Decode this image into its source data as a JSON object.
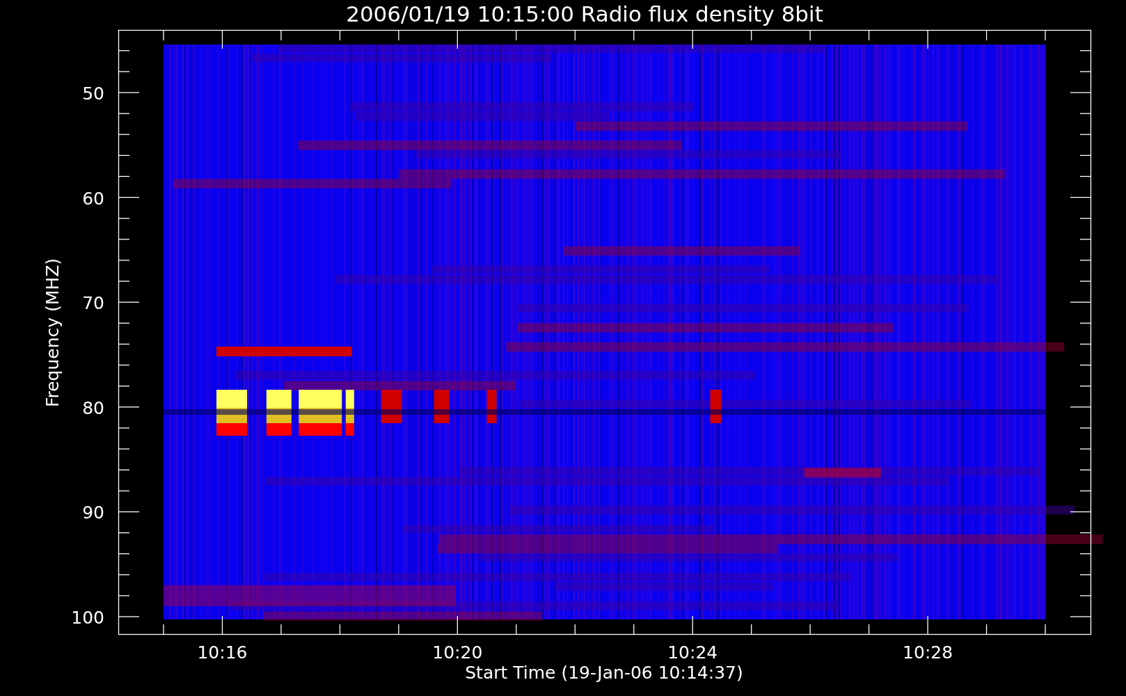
{
  "title": "2006/01/19 10:15:00 Radio flux density 8bit",
  "y_axis": {
    "label": "Frequency (MHZ)",
    "ticks": [
      "50",
      "60",
      "70",
      "80",
      "90",
      "100"
    ]
  },
  "x_axis": {
    "label": "Start Time (19-Jan-06 10:14:37)",
    "ticks": [
      "10:16",
      "10:20",
      "10:24",
      "10:28"
    ]
  }
}
